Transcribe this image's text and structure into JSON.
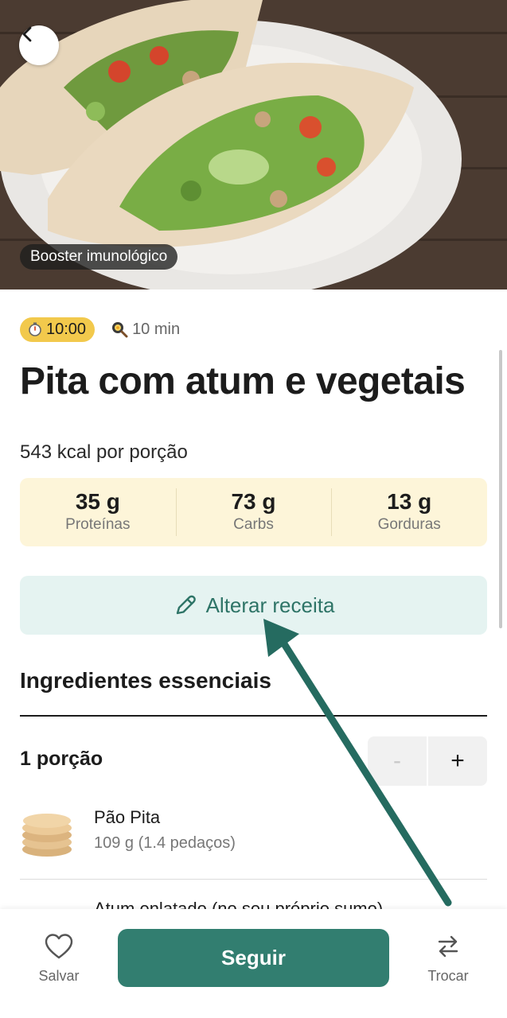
{
  "hero": {
    "tag": "Booster imunológico"
  },
  "meta": {
    "timer": "10:00",
    "duration": "10 min"
  },
  "recipe": {
    "title": "Pita com atum e vegetais",
    "kcal": "543 kcal por porção"
  },
  "macros": [
    {
      "value": "35 g",
      "label": "Proteínas"
    },
    {
      "value": "73 g",
      "label": "Carbs"
    },
    {
      "value": "13 g",
      "label": "Gorduras"
    }
  ],
  "edit_button": {
    "label": "Alterar receita"
  },
  "ingredients": {
    "section_title": "Ingredientes essenciais",
    "portions_label": "1 porção",
    "minus": "-",
    "plus": "+",
    "items": [
      {
        "name": "Pão Pita",
        "quantity": "109 g (1.4 pedaços)",
        "icon": "pita-bread-image"
      },
      {
        "name": "Atum enlatado (no seu próprio sumo)",
        "quantity": "",
        "icon": "tuna-image"
      }
    ]
  },
  "bottom_bar": {
    "save_label": "Salvar",
    "follow_label": "Seguir",
    "swap_label": "Trocar"
  },
  "colors": {
    "accent": "#327e70",
    "accent_light": "#e5f3f1",
    "timer_chip": "#f2c94c",
    "macros_bg": "#fdf5d9",
    "annotation_arrow": "#256b60"
  }
}
